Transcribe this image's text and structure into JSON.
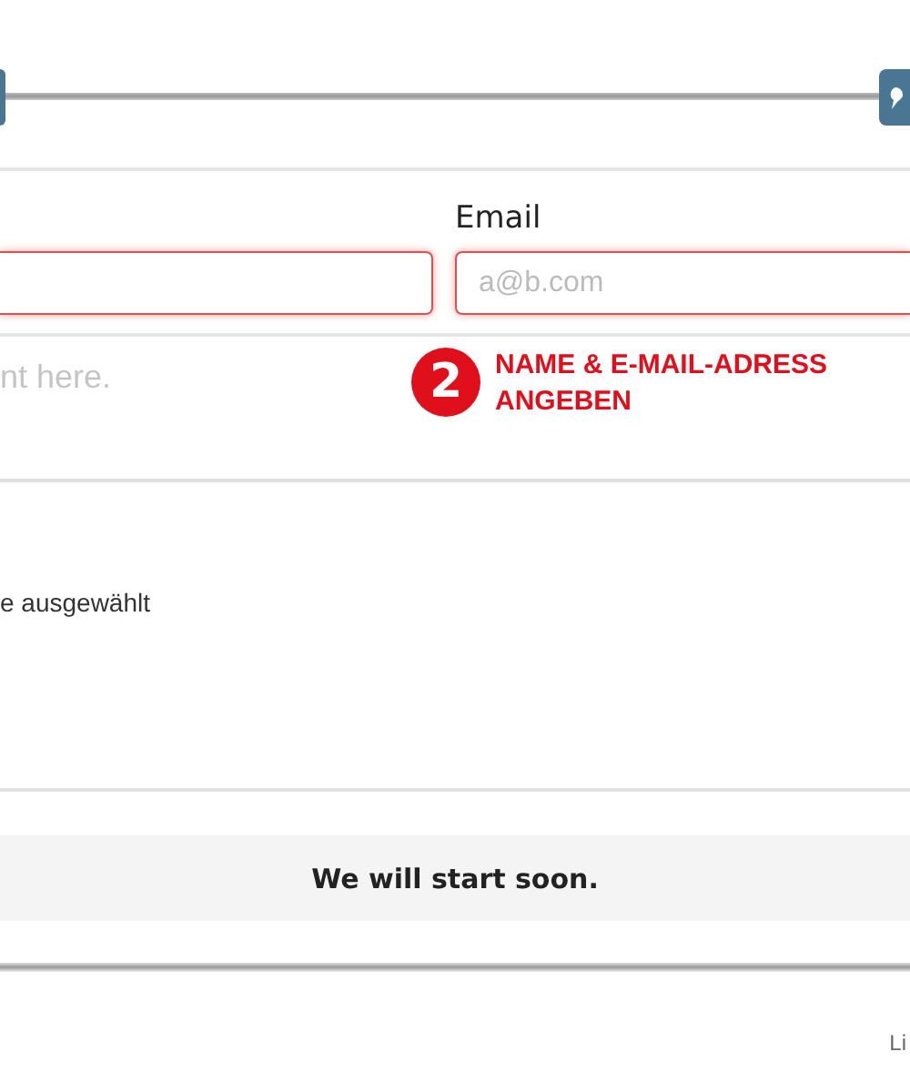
{
  "top_bar": {
    "buttons": [
      {
        "kind": "plain"
      },
      {
        "kind": "icon"
      }
    ]
  },
  "form": {
    "email_label": "Email",
    "name_field": {
      "invalid": true
    },
    "email_field": {
      "placeholder": "a@b.com",
      "invalid": true
    },
    "comment_field": {
      "placeholder": "nt here."
    },
    "selection_text": "e ausgewählt"
  },
  "annotation": {
    "number": "2",
    "lines": [
      "NAME & E-MAIL-ADRESS",
      "ANGEBEN"
    ]
  },
  "banner": {
    "text": "We will start soon."
  },
  "footer": {
    "link": "Li"
  }
}
